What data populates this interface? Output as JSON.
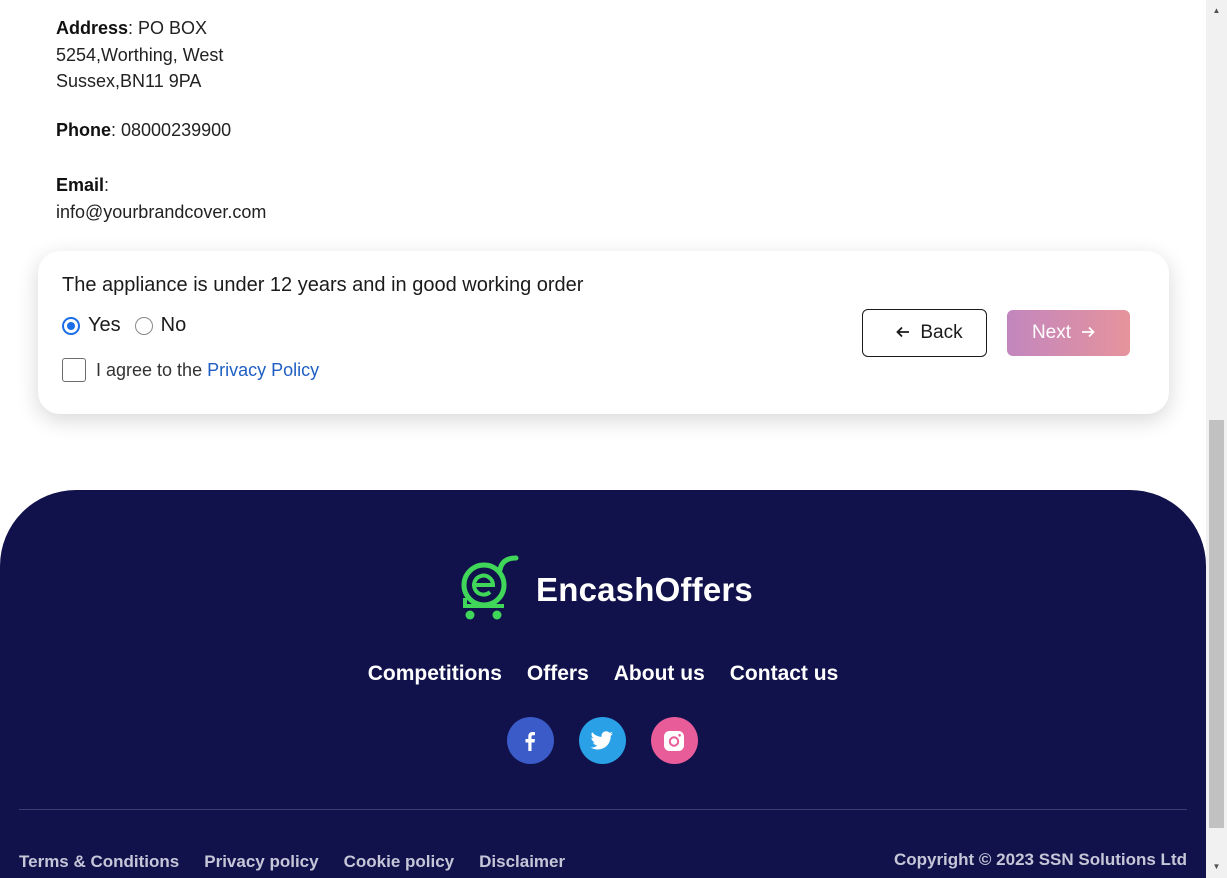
{
  "contact": {
    "address_label": "Address",
    "address_value": ": PO BOX 5254,Worthing, West Sussex,BN11 9PA",
    "phone_label": "Phone",
    "phone_value": ": 08000239900",
    "email_label": "Email",
    "email_colon": ":",
    "email_value": "info@yourbrandcover.com"
  },
  "question": {
    "text": "The appliance is under 12 years and in good working order",
    "options": [
      {
        "label": "Yes",
        "selected": true
      },
      {
        "label": "No",
        "selected": false
      }
    ],
    "agree_text": "I agree to the",
    "agree_link": "Privacy Policy",
    "agree_checked": false,
    "back_label": "Back",
    "next_label": "Next"
  },
  "footer": {
    "brand": "EncashOffers",
    "nav": [
      "Competitions",
      "Offers",
      "About us",
      "Contact us"
    ],
    "socials": [
      "facebook-icon",
      "twitter-icon",
      "instagram-icon"
    ],
    "legal": [
      "Terms & Conditions",
      "Privacy policy",
      "Cookie policy",
      "Disclaimer"
    ],
    "copyright": "Copyright © 2023 SSN Solutions Ltd"
  },
  "colors": {
    "footer_bg": "#11124b",
    "accent_radio": "#1a6ee8",
    "link": "#1f5fc4",
    "next_gradient_start": "#c286be",
    "next_gradient_end": "#e6939c",
    "logo_green": "#3fd65a"
  }
}
